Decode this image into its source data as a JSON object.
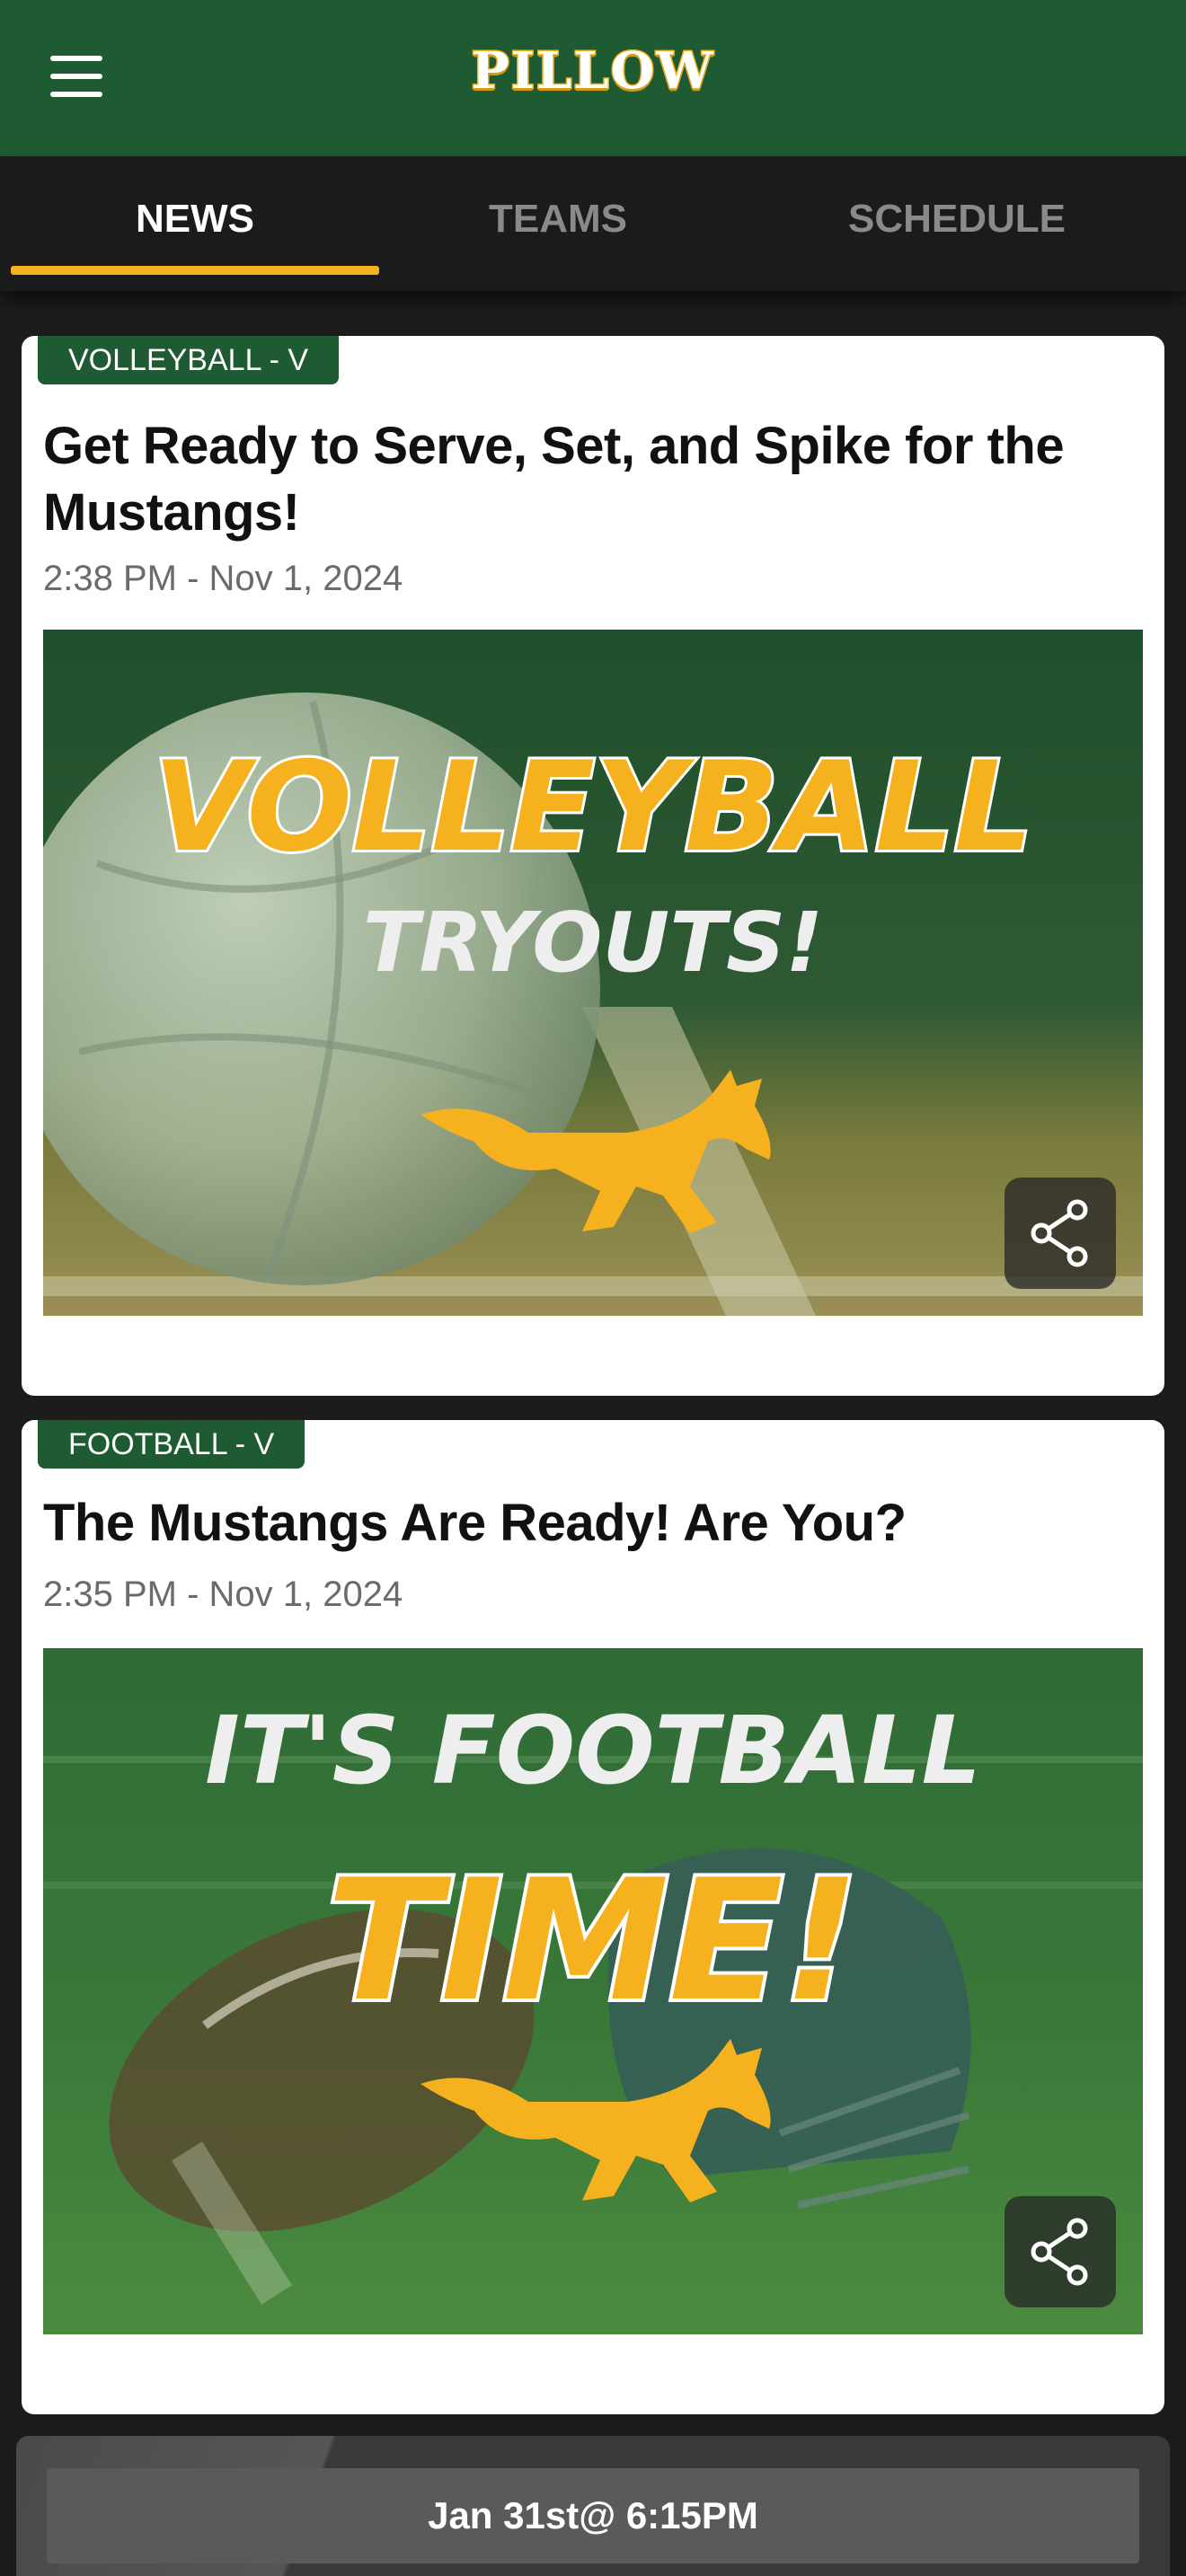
{
  "app": {
    "title": "PILLOW"
  },
  "tabs": [
    {
      "label": "NEWS",
      "active": true
    },
    {
      "label": "TEAMS",
      "active": false
    },
    {
      "label": "SCHEDULE",
      "active": false
    }
  ],
  "colors": {
    "header_green": "#1f5b32",
    "accent_gold": "#f6b21e",
    "tab_bar": "#1b1b1b"
  },
  "articles": [
    {
      "tag": "VOLLEYBALL - V",
      "title": "Get Ready to Serve, Set, and Spike for the Mustangs!",
      "time": "2:38 PM - Nov 1, 2024",
      "image_text": [
        "VOLLEYBALL",
        "TRYOUTS!"
      ],
      "share_icon": "share-icon"
    },
    {
      "tag": "FOOTBALL - V",
      "title": "The Mustangs Are Ready! Are You?",
      "time": "2:35 PM - Nov 1, 2024",
      "image_text": [
        "IT'S FOOTBALL",
        "TIME!"
      ],
      "share_icon": "share-icon"
    }
  ],
  "event": {
    "label": "Jan 31st@ 6:15PM"
  }
}
